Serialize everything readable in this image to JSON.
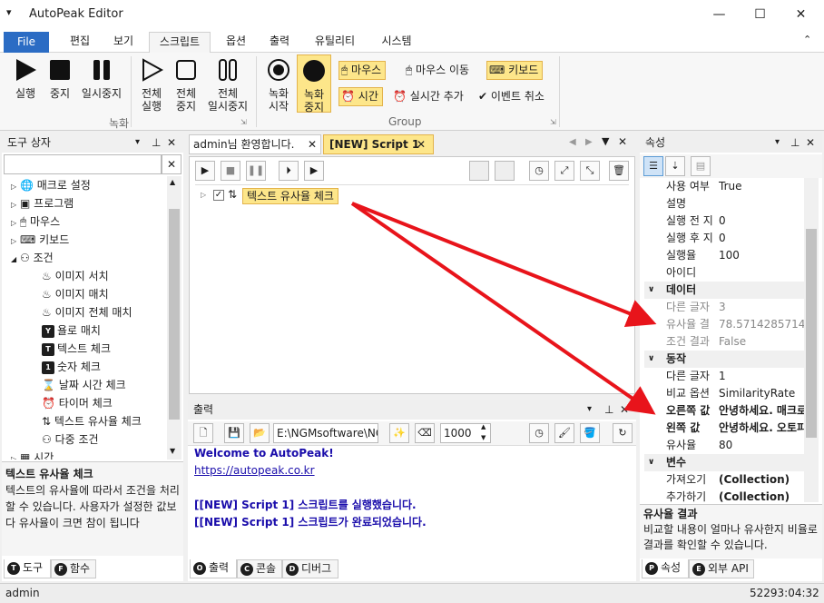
{
  "window": {
    "title": "AutoPeak Editor",
    "min": "—",
    "max": "☐",
    "close": "✕"
  },
  "menu": {
    "file": "File",
    "tabs": [
      "편집",
      "보기",
      "스크립트",
      "옵션",
      "출력",
      "유틸리티",
      "시스템"
    ]
  },
  "ribbon": {
    "record": [
      "실행",
      "중지",
      "일시중지"
    ],
    "full": [
      "전체\n실행",
      "전체\n중지",
      "전체\n일시중지"
    ],
    "rec2": [
      "녹화\n시작",
      "녹화\n중지"
    ],
    "group_record": "녹화",
    "group_group": "Group",
    "chips": [
      "마우스",
      "마우스 이동",
      "키보드",
      "시간",
      "실시간 추가",
      "이벤트 취소"
    ]
  },
  "toolbox": {
    "title": "도구 상자",
    "items": [
      "매크로 설정",
      "프로그램",
      "마우스",
      "키보드",
      "조건"
    ],
    "sub": [
      "이미지 서치",
      "이미지 매치",
      "이미지 전체 매치",
      "욜로 매치",
      "텍스트 체크",
      "숫자 체크",
      "날짜 시간 체크",
      "타이머 체크",
      "텍스트 유사율 체크",
      "다중 조건"
    ],
    "partial": "시간",
    "desc_title": "텍스트 유사율 체크",
    "desc": "텍스트의 유사율에 따라서 조건을 처리할 수 있습니다. 사용자가 설정한 값보다 유사율이 크면 참이 됩니다",
    "tabs": [
      "도구",
      "함수"
    ],
    "tab_letters": [
      "T",
      "F"
    ]
  },
  "editor": {
    "tabs": [
      "admin님 환영합니다.",
      "[NEW] Script 1"
    ],
    "node": "텍스트 유사율 체크"
  },
  "output": {
    "title": "출력",
    "path": "E:\\NGMsoftware\\NG",
    "num": "1000",
    "lines": [
      "Welcome to AutoPeak!",
      "https://autopeak.co.kr",
      "",
      "[[NEW] Script 1] 스크립트를 실행했습니다.",
      "[[NEW] Script 1] 스크립트가 완료되었습니다."
    ],
    "tabs": [
      "출력",
      "콘솔",
      "디버그"
    ],
    "tab_letters": [
      "O",
      "C",
      "D"
    ]
  },
  "props": {
    "title": "속성",
    "rows1": [
      [
        "사용 여부",
        "True"
      ],
      [
        "설명",
        ""
      ],
      [
        "실행 전 지",
        "0"
      ],
      [
        "실행 후 지",
        "0"
      ],
      [
        "실행율",
        "100"
      ],
      [
        "아이디",
        ""
      ]
    ],
    "cat_data": "데이터",
    "rows2": [
      [
        "다른 글자",
        "3"
      ],
      [
        "유사율 결",
        "78.57142857142"
      ],
      [
        "조건 결과",
        "False"
      ]
    ],
    "cat_action": "동작",
    "rows3": [
      [
        "다른 글자",
        "1"
      ],
      [
        "비교 옵션",
        "SimilarityRate"
      ],
      [
        "오른쪽 값",
        "안녕하세요. 매크로"
      ],
      [
        "왼쪽 값",
        "안녕하세요. 오토피"
      ],
      [
        "유사율",
        "80"
      ]
    ],
    "cat_var": "변수",
    "rows4": [
      [
        "가져오기",
        "(Collection)"
      ],
      [
        "추가하기",
        "(Collection)"
      ]
    ],
    "desc_title": "유사율 결과",
    "desc": "비교할 내용이 얼마나 유사한지 비율로 결과를 확인할 수 있습니다.",
    "tabs": [
      "속성",
      "외부 API"
    ],
    "tab_letters": [
      "P",
      "E"
    ]
  },
  "status": {
    "user": "admin",
    "time": "52293:04:32"
  },
  "colors": {
    "accent": "#2b6cc4",
    "highlight": "#fde68a",
    "arrow": "#e8141b",
    "link": "#1a0dab"
  }
}
